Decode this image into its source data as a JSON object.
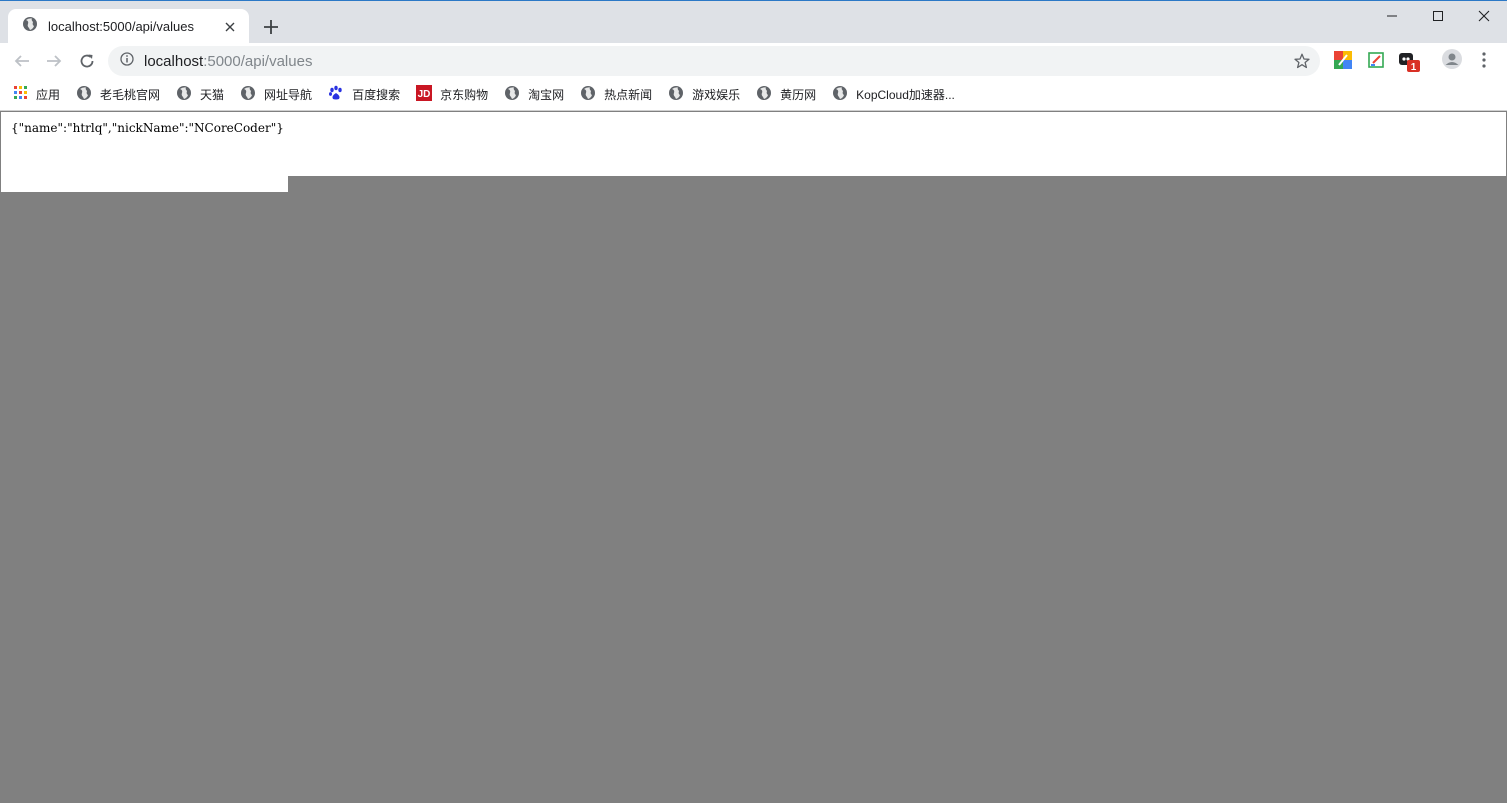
{
  "tab": {
    "title": "localhost:5000/api/values"
  },
  "address_bar": {
    "host": "localhost",
    "rest": ":5000/api/values"
  },
  "bookmarks": [
    {
      "label": "应用",
      "icon": "apps-grid-icon"
    },
    {
      "label": "老毛桃官网",
      "icon": "globe-icon"
    },
    {
      "label": "天猫",
      "icon": "globe-icon"
    },
    {
      "label": "网址导航",
      "icon": "globe-icon"
    },
    {
      "label": "百度搜索",
      "icon": "baidu-paw-icon"
    },
    {
      "label": "京东购物",
      "icon": "jd-icon"
    },
    {
      "label": "淘宝网",
      "icon": "globe-icon"
    },
    {
      "label": "热点新闻",
      "icon": "globe-icon"
    },
    {
      "label": "游戏娱乐",
      "icon": "globe-icon"
    },
    {
      "label": "黄历网",
      "icon": "globe-icon"
    },
    {
      "label": "KopCloud加速器...",
      "icon": "globe-icon"
    }
  ],
  "jd_icon_text": "JD",
  "extension_badge": "1",
  "page": {
    "body_text": "{\"name\":\"htrlq\",\"nickName\":\"NCoreCoder\"}"
  },
  "colors": {
    "tabstrip_bg": "#dee1e6",
    "omnibox_bg": "#f1f3f4",
    "overlay_gray": "#808080",
    "badge_red": "#d93025"
  }
}
